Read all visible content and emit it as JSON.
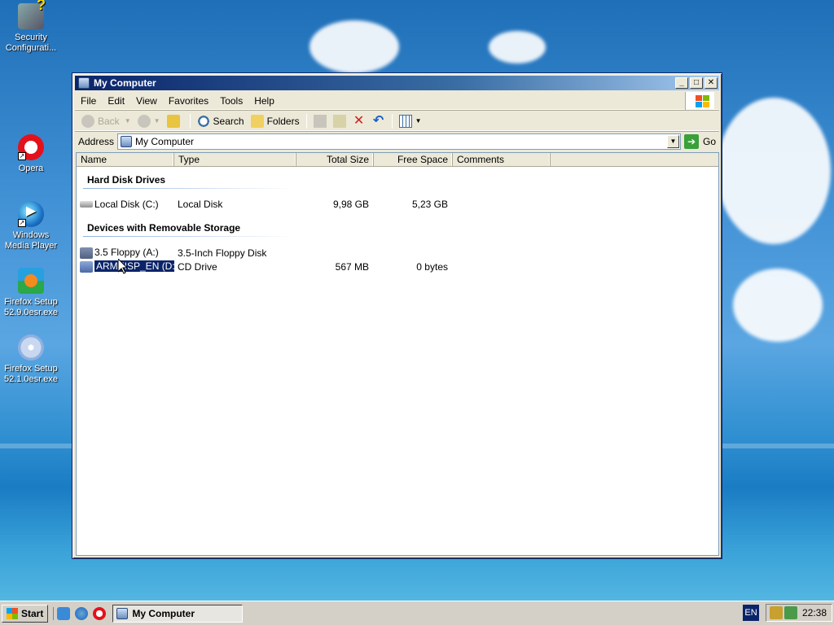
{
  "desktop": {
    "icons": [
      {
        "label": "Security Configurati...",
        "icon": "security-config-icon"
      },
      {
        "label": "Opera",
        "icon": "opera-icon"
      },
      {
        "label": "Windows Media Player",
        "icon": "media-player-icon"
      },
      {
        "label": "Firefox Setup 52.9.0esr.exe",
        "icon": "installer-icon"
      },
      {
        "label": "Firefox Setup 52.1.0esr.exe",
        "icon": "installer-cd-icon"
      }
    ]
  },
  "window": {
    "title": "My Computer",
    "menu": [
      "File",
      "Edit",
      "View",
      "Favorites",
      "Tools",
      "Help"
    ],
    "toolbar": {
      "back": "Back",
      "search": "Search",
      "folders": "Folders"
    },
    "address": {
      "label": "Address",
      "value": "My Computer",
      "go": "Go"
    },
    "columns": [
      "Name",
      "Type",
      "Total Size",
      "Free Space",
      "Comments"
    ],
    "groups": [
      {
        "title": "Hard Disk Drives",
        "items": [
          {
            "name": "Local Disk (C:)",
            "type": "Local Disk",
            "total": "9,98 GB",
            "free": "5,23 GB",
            "icon": "hard-disk-icon"
          }
        ]
      },
      {
        "title": "Devices with Removable Storage",
        "items": [
          {
            "name": "3.5 Floppy (A:)",
            "type": "3.5-Inch Floppy Disk",
            "total": "",
            "free": "",
            "icon": "floppy-icon"
          },
          {
            "name": "ARMEISP_EN (D:)",
            "type": "CD Drive",
            "total": "567 MB",
            "free": "0 bytes",
            "icon": "cd-drive-icon",
            "selected": true
          }
        ]
      }
    ]
  },
  "taskbar": {
    "start": "Start",
    "task": "My Computer",
    "lang": "EN",
    "clock": "22:38"
  },
  "colors": {
    "title_start": "#0a246a",
    "title_end": "#a6caf0",
    "selection": "#0a246a"
  }
}
